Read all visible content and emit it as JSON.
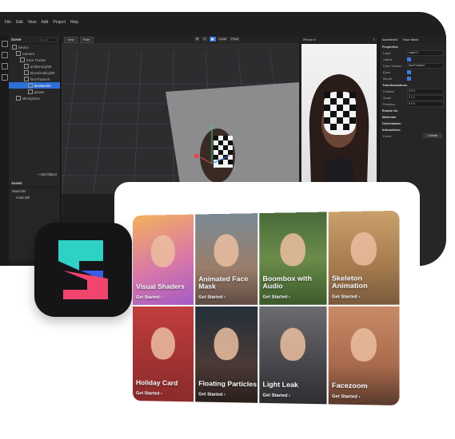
{
  "menubar": [
    "File",
    "Edit",
    "View",
    "Add",
    "Project",
    "Help"
  ],
  "scene": {
    "header": "Scene",
    "search_placeholder": "Search",
    "items": [
      {
        "label": "Device",
        "indent": 0
      },
      {
        "label": "Camera",
        "indent": 1
      },
      {
        "label": "Face Tracker",
        "indent": 2
      },
      {
        "label": "ambientLight0",
        "indent": 3
      },
      {
        "label": "directionalLight0",
        "indent": 3
      },
      {
        "label": "faceTracker0",
        "indent": 3
      },
      {
        "label": "faceMesh0",
        "indent": 4,
        "selected": true
      },
      {
        "label": "planes",
        "indent": 4
      },
      {
        "label": "Microphone",
        "indent": 1
      }
    ],
    "add_object": "+ Add Object"
  },
  "assets": {
    "header": "Assets",
    "items": [
      "Materials",
      "material0"
    ]
  },
  "viewport": {
    "view_label": "View",
    "filter_label": "Filter",
    "local_label": "Local",
    "pivot_label": "Pivot"
  },
  "preview": {
    "device": "iPhone 8"
  },
  "inspector": {
    "tab1": "faceMesh0",
    "tab2": "Face Mesh",
    "sections": [
      "Properties",
      "Transformations",
      "Enable for",
      "Materials",
      "Deformation",
      "Interactions"
    ],
    "props": [
      {
        "k": "Layer",
        "v": "Layer 0"
      },
      {
        "k": "Visible",
        "v": ""
      },
      {
        "k": "Face Tracker",
        "v": "faceTracker0"
      },
      {
        "k": "Eyes",
        "v": ""
      },
      {
        "k": "Mouth",
        "v": ""
      }
    ],
    "transforms": [
      {
        "k": "Position",
        "v": "0   0   0"
      },
      {
        "k": "Scale",
        "v": "1   1   1"
      },
      {
        "k": "Rotation",
        "v": "0   0   0"
      }
    ],
    "event_label": "Event",
    "create_label": "Create"
  },
  "tiles": [
    {
      "title": "Visual Shaders",
      "cta": "Get Started",
      "bg": "linear-gradient(160deg,#f3b15c 0%,#d978a8 55%,#a45bc6 100%)"
    },
    {
      "title": "Animated Face Mask",
      "cta": "Get Started",
      "bg": "linear-gradient(180deg,#7a8a94 0%,#9a7d6a 60%,#5f4a42 100%)"
    },
    {
      "title": "Boombox with Audio",
      "cta": "Get Started",
      "bg": "linear-gradient(180deg,#4a6b3a 0%,#6b8c4a 50%,#3b5a2a 100%)"
    },
    {
      "title": "Skeleton Animation",
      "cta": "Get Started",
      "bg": "linear-gradient(180deg,#c9a06b 0%,#a47a4e 60%,#7a5a3c 100%)"
    },
    {
      "title": "Holiday Card",
      "cta": "Get Started",
      "bg": "linear-gradient(180deg,#c23d3d 0%,#8a2b2b 100%)"
    },
    {
      "title": "Floating Particles",
      "cta": "Get Started",
      "bg": "linear-gradient(180deg,#24303a 0%,#4a3a36 60%,#2a1f1c 100%)"
    },
    {
      "title": "Light Leak",
      "cta": "Get Started",
      "bg": "linear-gradient(180deg,#6c6c70 0%,#2e2e32 100%)"
    },
    {
      "title": "Facezoom",
      "cta": "Get Started",
      "bg": "linear-gradient(180deg,#c88a66 0%,#a86a4c 60%,#5a3a2c 100%)"
    }
  ],
  "colors": {
    "accent": "#3d7be0",
    "logo_cyan": "#2fd1c4",
    "logo_pink": "#f2456e",
    "logo_blue": "#3a5ce6"
  }
}
